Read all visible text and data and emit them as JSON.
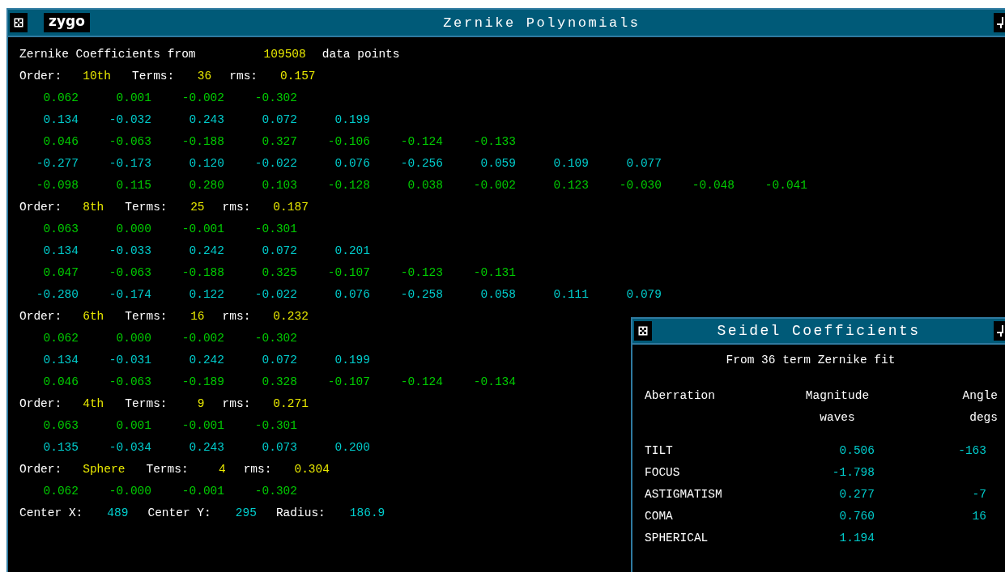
{
  "window": {
    "title": "Zernike Polynomials",
    "logo": "zygo"
  },
  "summary": {
    "prefix": "Zernike Coefficients from",
    "points": "109508",
    "suffix": "data points"
  },
  "fits": [
    {
      "order_label": "Order:",
      "order": "10th",
      "terms_label": "Terms:",
      "terms": "36",
      "rms_label": "rms:",
      "rms": "0.157",
      "rows": [
        {
          "color": "#00cc00",
          "values": [
            "0.062",
            "0.001",
            "-0.002",
            "-0.302"
          ]
        },
        {
          "color": "#00cccc",
          "values": [
            "0.134",
            "-0.032",
            "0.243",
            "0.072",
            "0.199"
          ]
        },
        {
          "color": "#00cc00",
          "values": [
            "0.046",
            "-0.063",
            "-0.188",
            "0.327",
            "-0.106",
            "-0.124",
            "-0.133"
          ]
        },
        {
          "color": "#00cccc",
          "values": [
            "-0.277",
            "-0.173",
            "0.120",
            "-0.022",
            "0.076",
            "-0.256",
            "0.059",
            "0.109",
            "0.077"
          ]
        },
        {
          "color": "#00cc00",
          "values": [
            "-0.098",
            "0.115",
            "0.280",
            "0.103",
            "-0.128",
            "0.038",
            "-0.002",
            "0.123",
            "-0.030",
            "-0.048",
            "-0.041"
          ]
        }
      ]
    },
    {
      "order_label": "Order:",
      "order": "8th",
      "terms_label": "Terms:",
      "terms": "25",
      "rms_label": "rms:",
      "rms": "0.187",
      "rows": [
        {
          "color": "#00cc00",
          "values": [
            "0.063",
            "0.000",
            "-0.001",
            "-0.301"
          ]
        },
        {
          "color": "#00cccc",
          "values": [
            "0.134",
            "-0.033",
            "0.242",
            "0.072",
            "0.201"
          ]
        },
        {
          "color": "#00cc00",
          "values": [
            "0.047",
            "-0.063",
            "-0.188",
            "0.325",
            "-0.107",
            "-0.123",
            "-0.131"
          ]
        },
        {
          "color": "#00cccc",
          "values": [
            "-0.280",
            "-0.174",
            "0.122",
            "-0.022",
            "0.076",
            "-0.258",
            "0.058",
            "0.111",
            "0.079"
          ]
        }
      ]
    },
    {
      "order_label": "Order:",
      "order": "6th",
      "terms_label": "Terms:",
      "terms": "16",
      "rms_label": "rms:",
      "rms": "0.232",
      "rows": [
        {
          "color": "#00cc00",
          "values": [
            "0.062",
            "0.000",
            "-0.002",
            "-0.302"
          ]
        },
        {
          "color": "#00cccc",
          "values": [
            "0.134",
            "-0.031",
            "0.242",
            "0.072",
            "0.199"
          ]
        },
        {
          "color": "#00cc00",
          "values": [
            "0.046",
            "-0.063",
            "-0.189",
            "0.328",
            "-0.107",
            "-0.124",
            "-0.134"
          ]
        }
      ]
    },
    {
      "order_label": "Order:",
      "order": "4th",
      "terms_label": "Terms:",
      "terms": "9",
      "rms_label": "rms:",
      "rms": "0.271",
      "rows": [
        {
          "color": "#00cc00",
          "values": [
            "0.063",
            "0.001",
            "-0.001",
            "-0.301"
          ]
        },
        {
          "color": "#00cccc",
          "values": [
            "0.135",
            "-0.034",
            "0.243",
            "0.073",
            "0.200"
          ]
        }
      ]
    },
    {
      "order_label": "Order:",
      "order": "Sphere",
      "terms_label": "Terms:",
      "terms": "4",
      "rms_label": "rms:",
      "rms": "0.304",
      "rows": [
        {
          "color": "#00cc00",
          "values": [
            "0.062",
            "-0.000",
            "-0.001",
            "-0.302"
          ]
        }
      ]
    }
  ],
  "center": [
    {
      "label": "Center X:",
      "value": "489"
    },
    {
      "label": "Center Y:",
      "value": "295"
    },
    {
      "label": "Radius:",
      "value": "186.9"
    }
  ],
  "seidel": {
    "title": "Seidel Coefficients",
    "subtitle": "From 36 term Zernike fit",
    "columns": [
      {
        "label": "Aberration"
      },
      {
        "label": "Magnitude",
        "unit": "waves"
      },
      {
        "label": "Angle",
        "unit": "degs"
      }
    ],
    "rows": [
      {
        "name": "TILT",
        "magnitude": "0.506",
        "angle": "-163"
      },
      {
        "name": "FOCUS",
        "magnitude": "-1.798"
      },
      {
        "name": "ASTIGMATISM",
        "magnitude": "0.277",
        "angle": "-7"
      },
      {
        "name": "COMA",
        "magnitude": "0.760",
        "angle": "16"
      },
      {
        "name": "SPHERICAL",
        "magnitude": "1.194"
      }
    ]
  }
}
